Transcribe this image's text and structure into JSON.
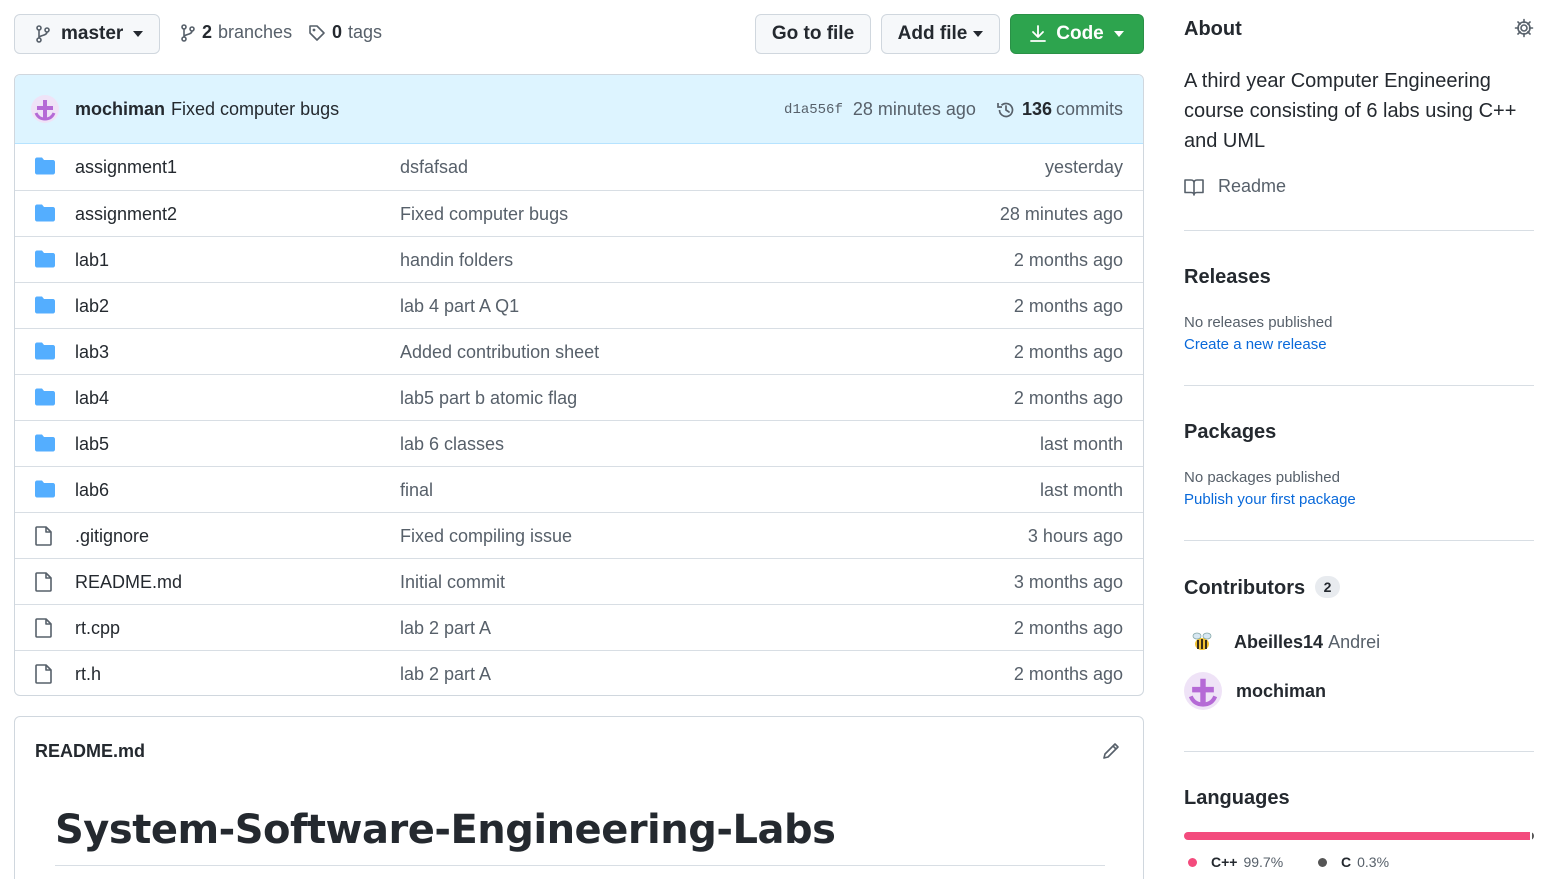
{
  "toolbar": {
    "branch": "master",
    "branches_count": "2",
    "branches_label": "branches",
    "tags_count": "0",
    "tags_label": "tags",
    "go_to_file": "Go to file",
    "add_file": "Add file",
    "code": "Code"
  },
  "latest_commit": {
    "author": "mochiman",
    "message": "Fixed computer bugs",
    "sha": "d1a556f",
    "time": "28 minutes ago",
    "commits_count": "136",
    "commits_label": "commits"
  },
  "files": [
    {
      "type": "folder",
      "name": "assignment1",
      "message": "dsfafsad",
      "time": "yesterday"
    },
    {
      "type": "folder",
      "name": "assignment2",
      "message": "Fixed computer bugs",
      "time": "28 minutes ago"
    },
    {
      "type": "folder",
      "name": "lab1",
      "message": "handin folders",
      "time": "2 months ago"
    },
    {
      "type": "folder",
      "name": "lab2",
      "message": "lab 4 part A Q1",
      "time": "2 months ago"
    },
    {
      "type": "folder",
      "name": "lab3",
      "message": "Added contribution sheet",
      "time": "2 months ago"
    },
    {
      "type": "folder",
      "name": "lab4",
      "message": "lab5 part b atomic flag",
      "time": "2 months ago"
    },
    {
      "type": "folder",
      "name": "lab5",
      "message": "lab 6 classes",
      "time": "last month"
    },
    {
      "type": "folder",
      "name": "lab6",
      "message": "final",
      "time": "last month"
    },
    {
      "type": "file",
      "name": ".gitignore",
      "message": "Fixed compiling issue",
      "time": "3 hours ago"
    },
    {
      "type": "file",
      "name": "README.md",
      "message": "Initial commit",
      "time": "3 months ago"
    },
    {
      "type": "file",
      "name": "rt.cpp",
      "message": "lab 2 part A",
      "time": "2 months ago"
    },
    {
      "type": "file",
      "name": "rt.h",
      "message": "lab 2 part A",
      "time": "2 months ago"
    }
  ],
  "readme": {
    "filename": "README.md",
    "heading": "System-Software-Engineering-Labs"
  },
  "sidebar": {
    "about_title": "About",
    "about_description": "A third year Computer Engineering course consisting of 6 labs using C++ and UML",
    "readme_link": "Readme",
    "releases_title": "Releases",
    "releases_empty": "No releases published",
    "releases_link": "Create a new release",
    "packages_title": "Packages",
    "packages_empty": "No packages published",
    "packages_link": "Publish your first package",
    "contributors_title": "Contributors",
    "contributors_count": "2",
    "contributors": [
      {
        "username": "Abeilles14",
        "fullname": "Andrei"
      },
      {
        "username": "mochiman",
        "fullname": ""
      }
    ],
    "languages_title": "Languages",
    "languages": [
      {
        "name": "C++",
        "percent": "99.7%",
        "value": 99.7,
        "color": "#f34b7d"
      },
      {
        "name": "C",
        "percent": "0.3%",
        "value": 0.3,
        "color": "#555555"
      }
    ]
  },
  "colors": {
    "accent_blue": "#0969da",
    "code_green": "#2da44e",
    "folder_blue": "#54aeff",
    "commit_bar": "#ddf4ff"
  }
}
